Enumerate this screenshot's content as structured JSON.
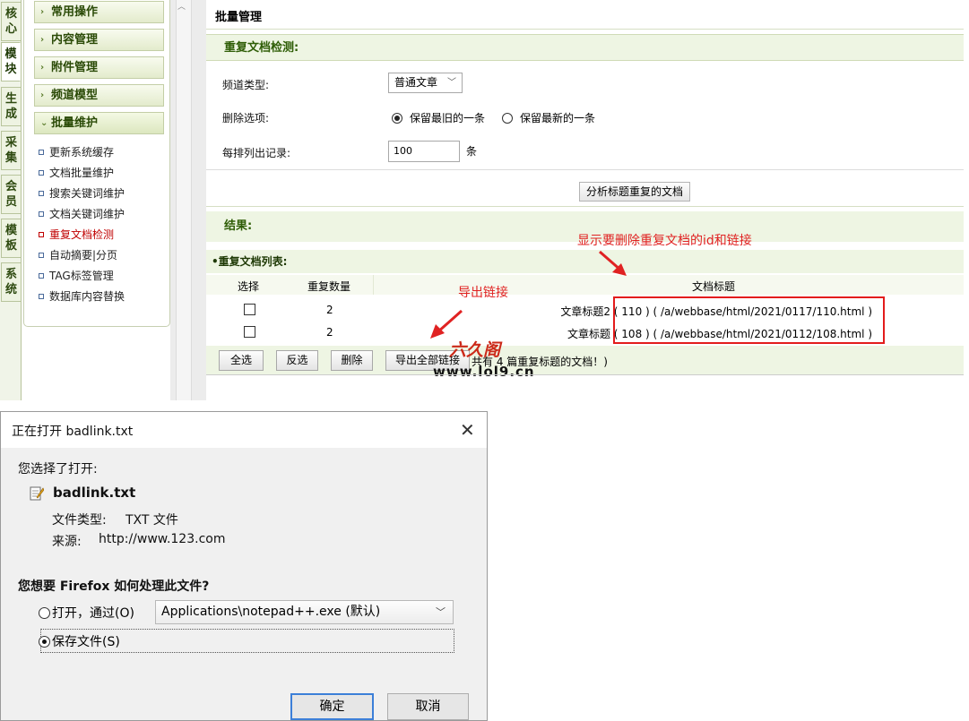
{
  "sidebar": {
    "tabs": [
      "核心",
      "模块",
      "生成",
      "采集",
      "会员",
      "模板",
      "系统"
    ],
    "menu": [
      "常用操作",
      "内容管理",
      "附件管理",
      "频道模型",
      "批量维护"
    ],
    "submenu": [
      "更新系统缓存",
      "文档批量维护",
      "搜索关键词维护",
      "文档关键词维护",
      "重复文档检测",
      "自动摘要|分页",
      "TAG标签管理",
      "数据库内容替换"
    ],
    "active_submenu": "重复文档检测"
  },
  "main": {
    "title": "批量管理",
    "section_title": "重复文档检测:",
    "channel_label": "频道类型:",
    "channel_value": "普通文章",
    "delete_label": "删除选项:",
    "delete_opt_old": "保留最旧的一条",
    "delete_opt_new": "保留最新的一条",
    "per_row_label": "每排列出记录:",
    "per_row_value": "100",
    "per_row_unit": "条",
    "analyze_button": "分析标题重复的文档",
    "result_title": "结果:",
    "list_title": "•重复文档列表:",
    "columns": {
      "select": "选择",
      "count": "重复数量",
      "doc_title": "文档标题"
    },
    "rows": [
      {
        "count": "2",
        "title": "文章标题2",
        "link": "( 110 ) ( /a/webbase/html/2021/0117/110.html )"
      },
      {
        "count": "2",
        "title": "文章标题",
        "link": "( 108 ) ( /a/webbase/html/2021/0112/108.html )"
      }
    ],
    "actions": {
      "select_all": "全选",
      "invert": "反选",
      "delete": "删除",
      "export": "导出全部链接",
      "note": "共有 4 篇重复标题的文档！)"
    },
    "annotations": {
      "top_note": "显示要删除重复文档的id和链接",
      "export_note": "导出链接"
    },
    "watermark": {
      "brand": "六久阁",
      "url": "www.lol9.cn"
    }
  },
  "dialog": {
    "title": "正在打开 badlink.txt",
    "close_symbol": "✕",
    "intro": "您选择了打开:",
    "filename": "badlink.txt",
    "filetype_label": "文件类型:",
    "filetype_value": "TXT 文件",
    "source_label": "来源:",
    "source_value": "http://www.123.com",
    "question": "您想要 Firefox 如何处理此文件?",
    "open_with_label": "打开，通过(O)",
    "open_with_app": "Applications\\notepad++.exe (默认)",
    "save_label": "保存文件(S)",
    "ok_button": "确定",
    "cancel_button": "取消"
  },
  "icons": {
    "file": "document-edit-icon",
    "checkbox": "checkbox-icon",
    "dropdown": "chevron-down-icon"
  },
  "colors": {
    "annotation_red": "#e02222",
    "section_green": "#2e5d06",
    "panel_bg": "#eef5e3",
    "ok_border": "#3c7fd8"
  }
}
